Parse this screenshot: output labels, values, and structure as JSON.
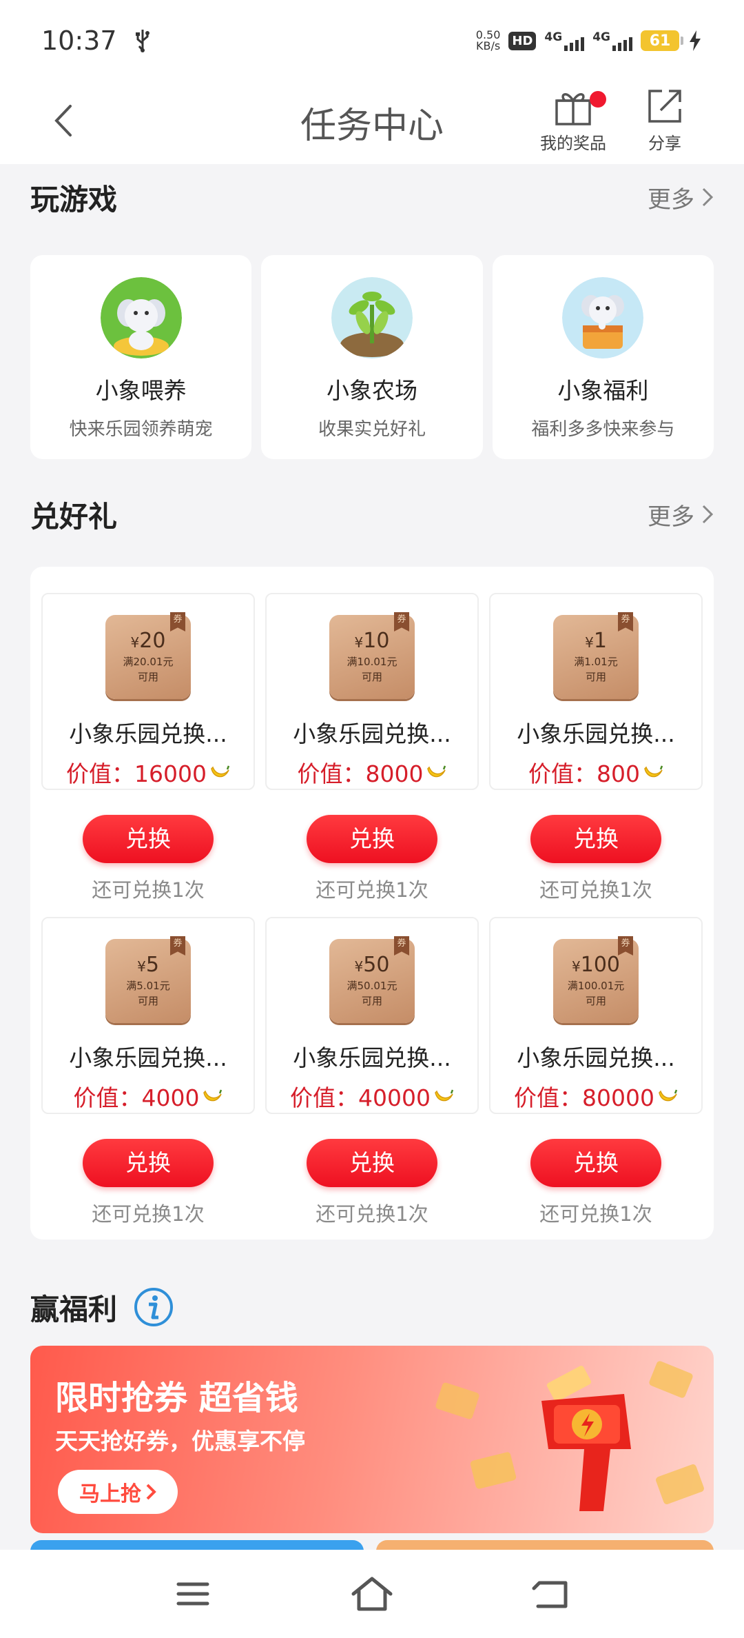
{
  "status_bar": {
    "time": "10:37",
    "net_speed_value": "0.50",
    "net_speed_unit": "KB/s",
    "hd": "HD",
    "sim1_tech": "4G",
    "sim2_tech": "4G",
    "battery": "61"
  },
  "header": {
    "title": "任务中心",
    "my_prizes_label": "我的奖品",
    "share_label": "分享"
  },
  "games_section": {
    "title": "玩游戏",
    "more": "更多",
    "items": [
      {
        "name": "小象喂养",
        "desc": "快来乐园领养萌宠"
      },
      {
        "name": "小象农场",
        "desc": "收果实兑好礼"
      },
      {
        "name": "小象福利",
        "desc": "福利多多快来参与"
      }
    ]
  },
  "gifts_section": {
    "title": "兑好礼",
    "more": "更多",
    "redeem_label": "兑换",
    "coupon_tag": "券",
    "coupon_usable": "可用",
    "items": [
      {
        "amount": "20",
        "condition": "满20.01元",
        "name": "小象乐园兑换...",
        "value": "价值：16000",
        "remain": "还可兑换1次"
      },
      {
        "amount": "10",
        "condition": "满10.01元",
        "name": "小象乐园兑换...",
        "value": "价值：8000",
        "remain": "还可兑换1次"
      },
      {
        "amount": "1",
        "condition": "满1.01元",
        "name": "小象乐园兑换...",
        "value": "价值：800",
        "remain": "还可兑换1次"
      },
      {
        "amount": "5",
        "condition": "满5.01元",
        "name": "小象乐园兑换...",
        "value": "价值：4000",
        "remain": "还可兑换1次"
      },
      {
        "amount": "50",
        "condition": "满50.01元",
        "name": "小象乐园兑换...",
        "value": "价值：40000",
        "remain": "还可兑换1次"
      },
      {
        "amount": "100",
        "condition": "满100.01元",
        "name": "小象乐园兑换...",
        "value": "价值：80000",
        "remain": "还可兑换1次"
      }
    ]
  },
  "welfare_section": {
    "title": "赢福利",
    "banner_title": "限时抢券 超省钱",
    "banner_subtitle": "天天抢好券，优惠享不停",
    "banner_button": "马上抢"
  },
  "colors": {
    "accent_red": "#ee1021",
    "value_red": "#d61e2a",
    "info_blue": "#2f8fd8",
    "battery_yellow": "#f3c42e"
  }
}
